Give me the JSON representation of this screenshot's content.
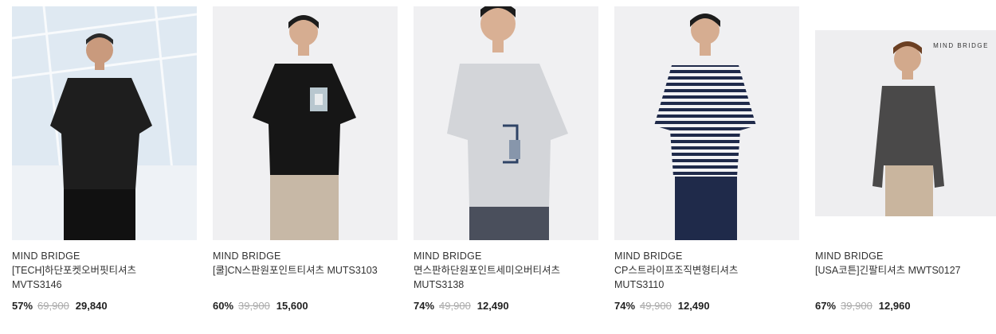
{
  "products": [
    {
      "brand": "MIND BRIDGE",
      "name": "[TECH]하단포켓오버핏티셔츠 MVTS3146",
      "discount": "57%",
      "original_price": "69,900",
      "sale_price": "29,840",
      "shirt_color": "#1e1e1e",
      "pants_color": "#111111",
      "background_color": "#dfe9f2"
    },
    {
      "brand": "MIND BRIDGE",
      "name": "[쿨]CN스판원포인트티셔츠 MUTS3103",
      "discount": "60%",
      "original_price": "39,900",
      "sale_price": "15,600",
      "shirt_color": "#161616",
      "pants_color": "#c7b8a6",
      "background_color": "#f0f0f2"
    },
    {
      "brand": "MIND BRIDGE",
      "name": "면스판하단원포인트세미오버티셔츠 MUTS3138",
      "discount": "74%",
      "original_price": "49,900",
      "sale_price": "12,490",
      "shirt_color": "#d3d5d9",
      "pants_color": "#4a4f5c",
      "background_color": "#f0f0f2"
    },
    {
      "brand": "MIND BRIDGE",
      "name": "CP스트라이프조직변형티셔츠 MUTS3110",
      "discount": "74%",
      "original_price": "49,900",
      "sale_price": "12,490",
      "shirt_color": "#f2f2f4",
      "pants_color": "#1f2a4a",
      "background_color": "#f0f0f2"
    },
    {
      "brand": "MIND BRIDGE",
      "name": "[USA코튼]긴팔티셔츠 MWTS0127",
      "discount": "67%",
      "original_price": "39,900",
      "sale_price": "12,960",
      "shirt_color": "#4a4949",
      "pants_color": "#c9b59e",
      "background_color": "#eeeef0",
      "image_caption": "MIND BRIDGE"
    }
  ]
}
